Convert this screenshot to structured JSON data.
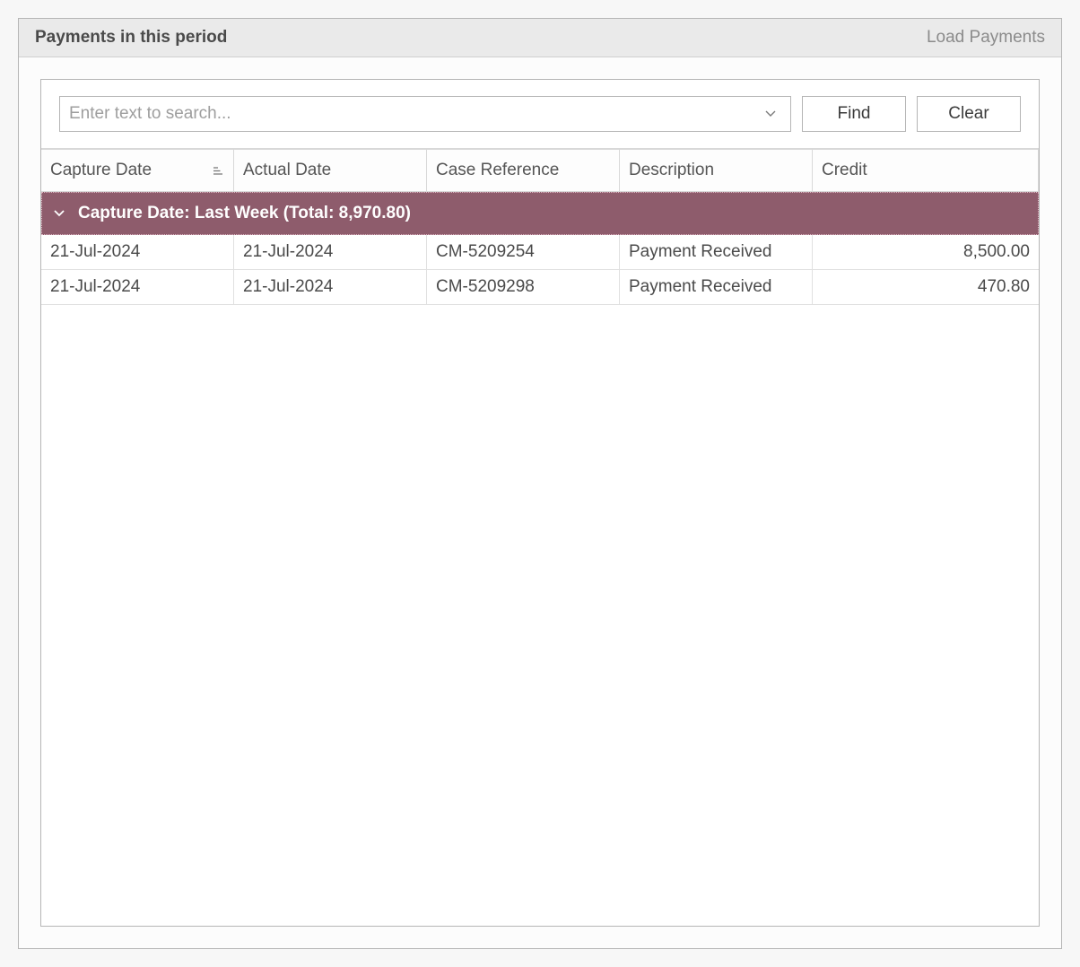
{
  "panel": {
    "title": "Payments in this period",
    "action": "Load Payments"
  },
  "toolbar": {
    "search_placeholder": "Enter text to search...",
    "search_value": "",
    "find_label": "Find",
    "clear_label": "Clear"
  },
  "grid": {
    "columns": [
      {
        "label": "Capture Date",
        "sorted": true
      },
      {
        "label": "Actual Date"
      },
      {
        "label": "Case Reference"
      },
      {
        "label": "Description"
      },
      {
        "label": "Credit"
      }
    ],
    "group": {
      "label": "Capture Date: Last Week (Total: 8,970.80)"
    },
    "rows": [
      {
        "capture_date": "21-Jul-2024",
        "actual_date": "21-Jul-2024",
        "case_ref": "CM-5209254",
        "description": "Payment Received",
        "credit": "8,500.00"
      },
      {
        "capture_date": "21-Jul-2024",
        "actual_date": "21-Jul-2024",
        "case_ref": "CM-5209298",
        "description": "Payment Received",
        "credit": "470.80"
      }
    ]
  }
}
